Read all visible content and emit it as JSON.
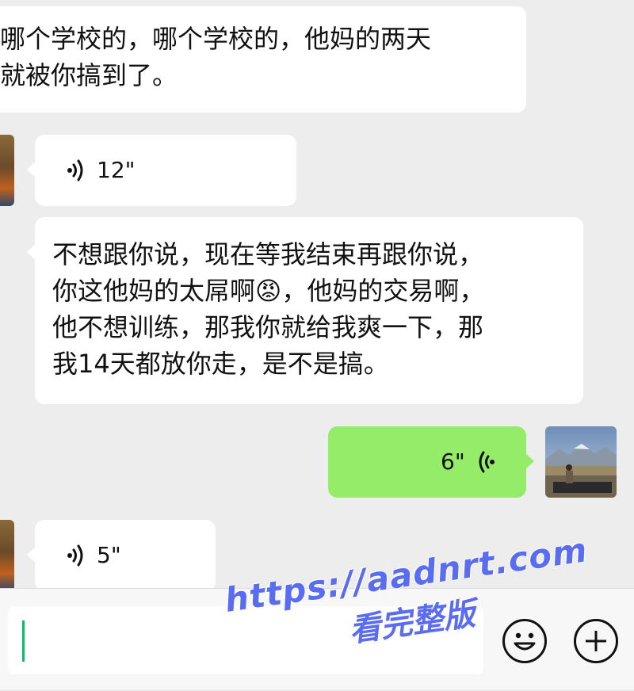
{
  "messages": [
    {
      "type": "text",
      "side": "left",
      "text": "哪个学校的，哪个学校的，他妈的两天\n就被你搞到了。"
    },
    {
      "type": "voice",
      "side": "left",
      "duration": "12\""
    },
    {
      "type": "text",
      "side": "left",
      "text": "不想跟你说，现在等我结束再跟你说，\n你这他妈的太屌啊😡，他妈的交易啊，\n他不想训练，那我你就给我爽一下，那\n我14天都放你走，是不是搞。"
    },
    {
      "type": "voice",
      "side": "right",
      "duration": "6\""
    },
    {
      "type": "voice",
      "side": "left",
      "duration": "5\""
    }
  ],
  "input": {
    "value": "",
    "emoji_icon": "smiley-face-icon",
    "add_icon": "plus-circle-icon"
  },
  "watermark": {
    "line1": "https://aadnrt.com",
    "line2": "看完整版"
  },
  "colors": {
    "background": "#ededed",
    "bubble_self": "#95ec69",
    "bubble_other": "#ffffff",
    "caret": "#07c160",
    "watermark": "#5a6cf0"
  }
}
